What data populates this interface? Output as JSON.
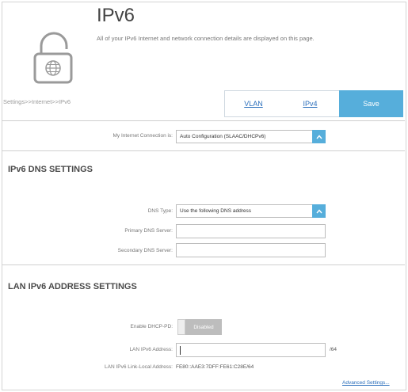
{
  "header": {
    "title": "IPv6",
    "description": "All of your IPv6 Internet and network connection details are displayed on this page.",
    "breadcrumb": "Settings>>Internet>>IPv6"
  },
  "toolbar": {
    "vlan_label": "VLAN",
    "ipv4_label": "IPv4",
    "save_label": "Save"
  },
  "connection": {
    "label": "My Internet Connection is:",
    "value": "Auto Configuration (SLAAC/DHCPv6)"
  },
  "dns": {
    "section_title": "IPv6 DNS SETTINGS",
    "type_label": "DNS Type:",
    "type_value": "Use the following DNS address",
    "primary_label": "Primary DNS Server:",
    "primary_value": "",
    "secondary_label": "Secondary DNS Server:",
    "secondary_value": ""
  },
  "lan": {
    "section_title": "LAN IPv6 ADDRESS SETTINGS",
    "dhcp_pd_label": "Enable DHCP-PD:",
    "dhcp_pd_state": "Disabled",
    "address_label": "LAN IPv6 Address:",
    "address_value": "",
    "prefix_suffix": "/64",
    "link_local_label": "LAN IPv6 Link-Local Address:",
    "link_local_value": "FE80::AAE3:7DFF:FE61:C28E/64"
  },
  "footer": {
    "advanced_link": "Advanced Settings..."
  },
  "colors": {
    "accent": "#56aedb",
    "link": "#2a6ebb"
  }
}
